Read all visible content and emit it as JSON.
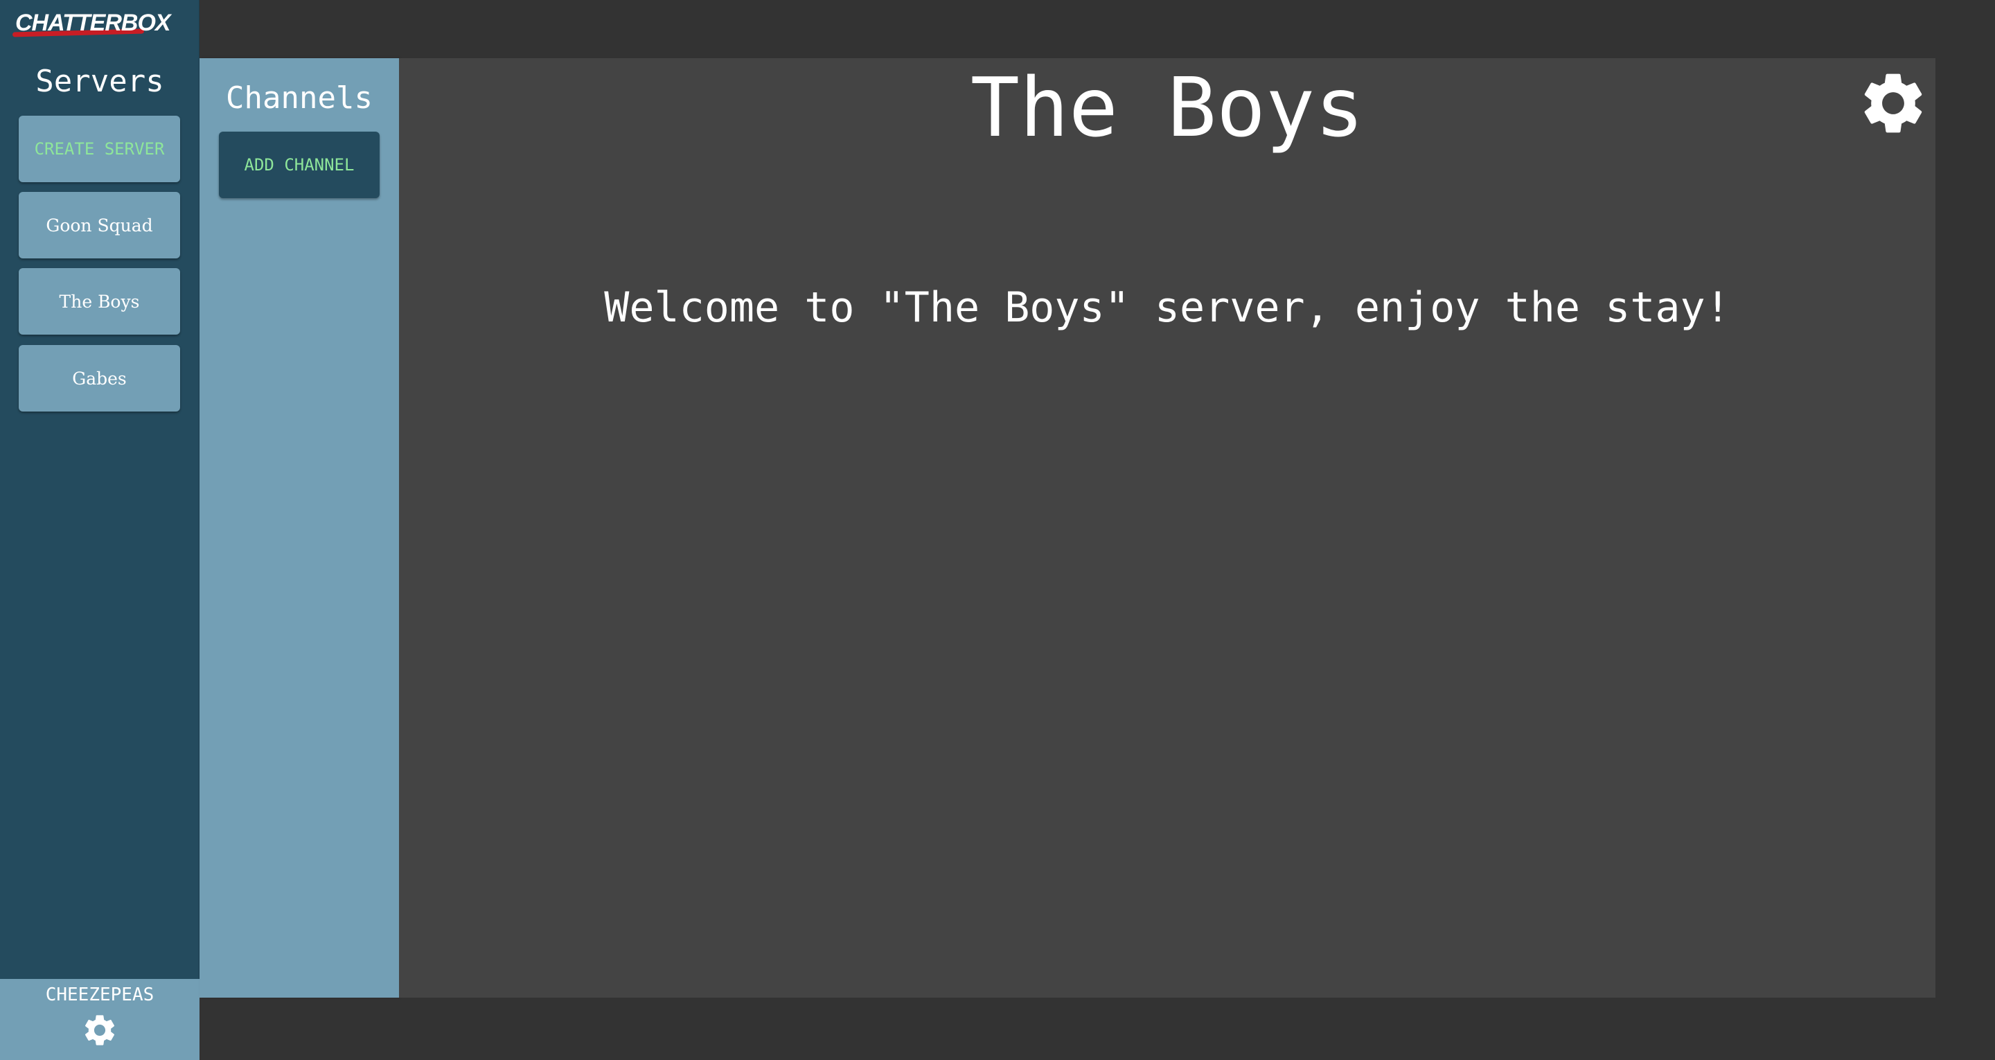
{
  "app": {
    "logo_text": "CHATTERBOX"
  },
  "servers": {
    "heading": "Servers",
    "create_label": "CREATE SERVER",
    "items": [
      {
        "label": "Goon Squad"
      },
      {
        "label": "The Boys"
      },
      {
        "label": "Gabes"
      }
    ]
  },
  "user": {
    "name": "CHEEZEPEAS",
    "settings_icon": "gear-icon"
  },
  "channels": {
    "heading": "Channels",
    "add_label": "ADD CHANNEL"
  },
  "main": {
    "title": "The Boys",
    "welcome": "Welcome to \"The Boys\" server, enjoy the stay!",
    "settings_icon": "gear-icon"
  },
  "colors": {
    "sidebar_dark": "#244b5e",
    "sidebar_light": "#739fb5",
    "accent_green": "#8ee69a",
    "main_bg": "#444444",
    "page_bg": "#333333",
    "logo_red": "#c81d25"
  }
}
